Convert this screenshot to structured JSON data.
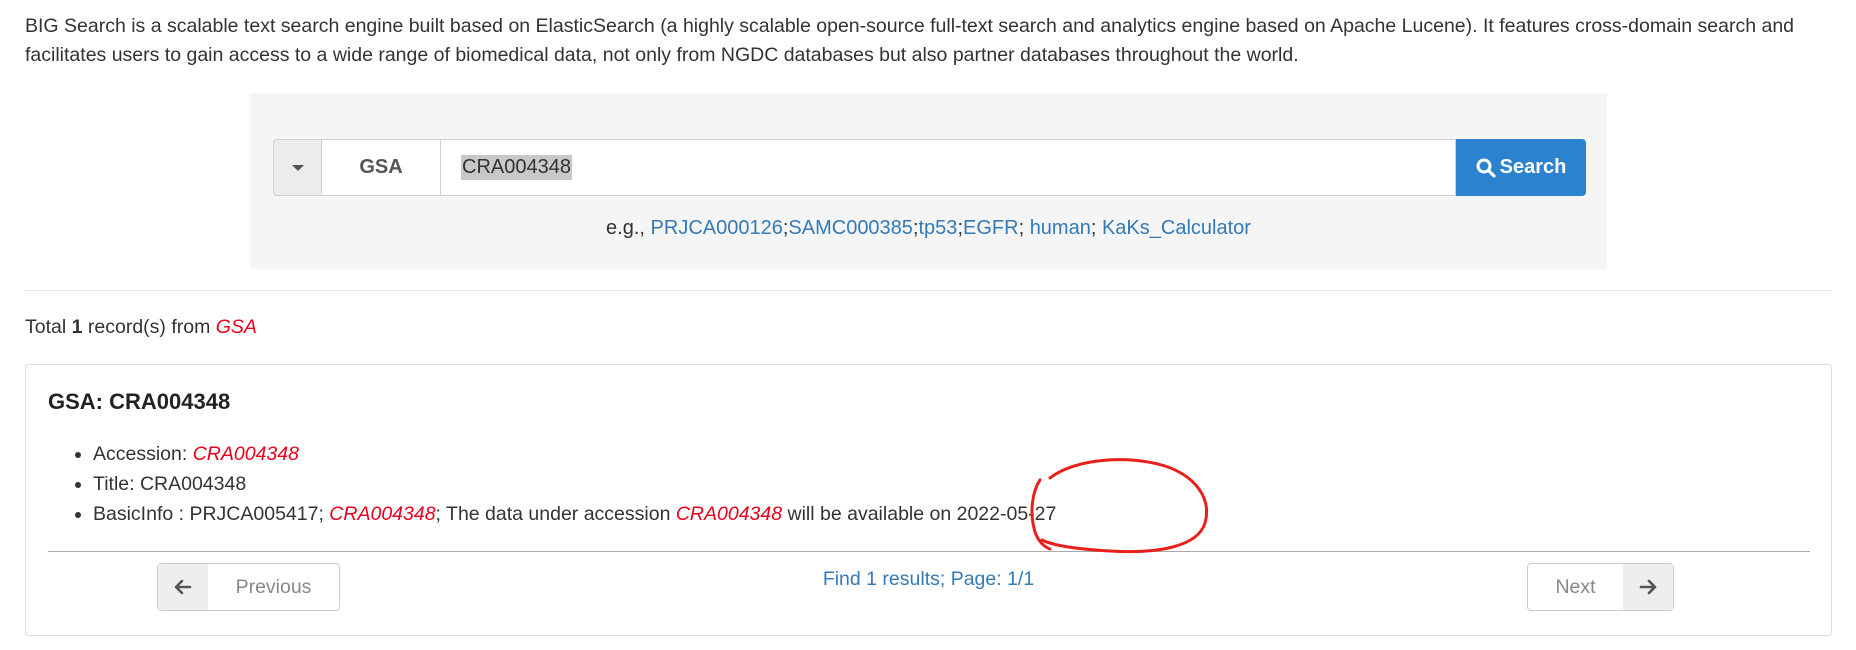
{
  "intro": {
    "text": "BIG Search is a scalable text search engine built based on ElasticSearch (a highly scalable open-source full-text search and analytics engine based on Apache Lucene). It features cross-domain search and facilitates users to gain access to a wide range of biomedical data, not only from NGDC databases but also partner databases throughout the world."
  },
  "search": {
    "database": "GSA",
    "query": "CRA004348",
    "button_label": "Search",
    "examples_prefix": "e.g., ",
    "examples": [
      "PRJCA000126",
      "SAMC000385",
      "tp53",
      "EGFR",
      "human",
      "KaKs_Calculator"
    ]
  },
  "results": {
    "total_prefix": "Total ",
    "total_count": "1",
    "total_middle": " record(s) from ",
    "source": "GSA"
  },
  "record": {
    "title": "GSA: CRA004348",
    "accession_label": "Accession: ",
    "accession": "CRA004348",
    "title_line": "Title: CRA004348",
    "basic_label": "BasicInfo : PRJCA005417; ",
    "basic_acc1": "CRA004348",
    "basic_mid": "; The data under accession ",
    "basic_acc2": "CRA004348",
    "basic_tail": " will be available on 2022-05-27"
  },
  "pager": {
    "previous": "Previous",
    "next": "Next",
    "info": "Find 1 results; Page: 1/1"
  },
  "colors": {
    "link": "#337ab7",
    "search_button": "#2b82cf",
    "highlight_red": "#e8001c",
    "annotation_red": "#e8201c"
  }
}
